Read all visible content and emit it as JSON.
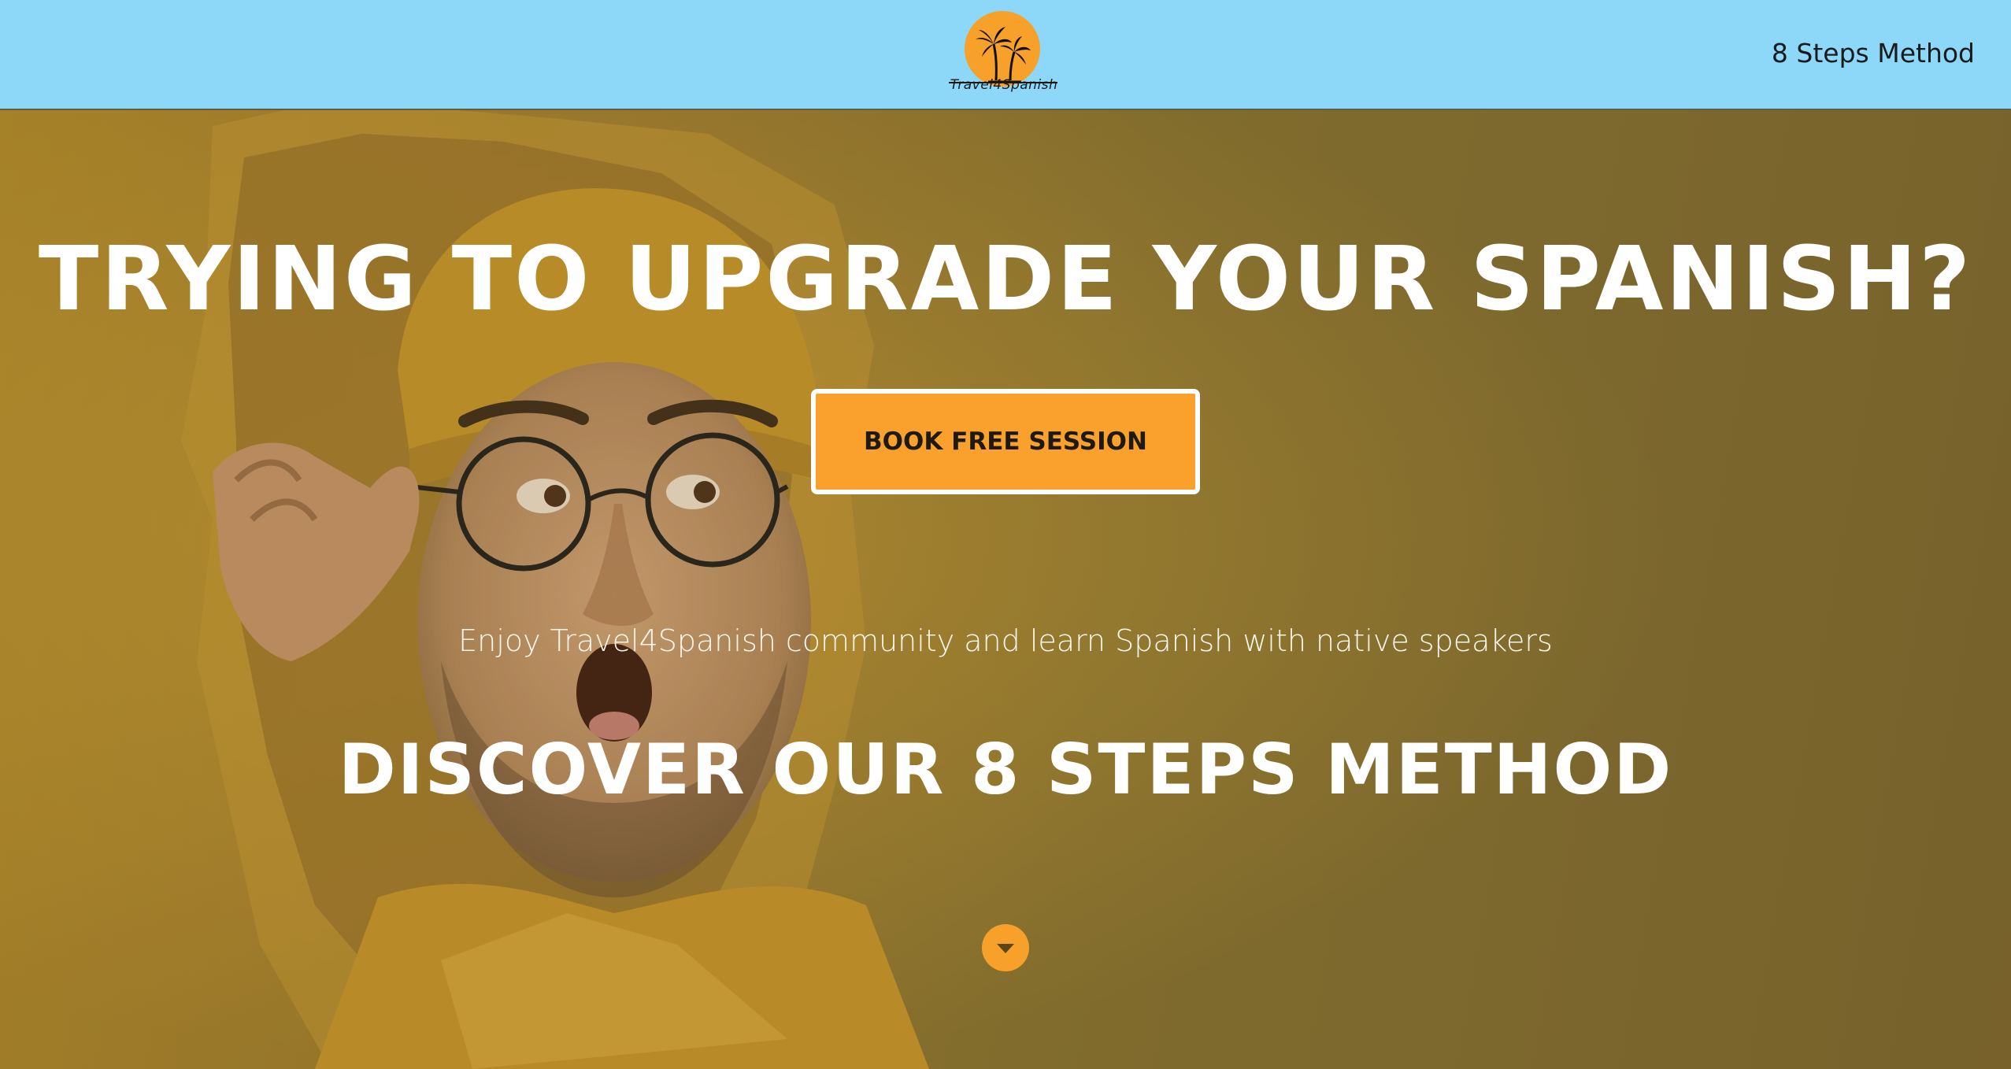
{
  "header": {
    "logo_text": "Travel4Spanish",
    "nav_link": "8 Steps Method"
  },
  "hero": {
    "title": "TRYING TO UPGRADE YOUR SPANISH?",
    "cta_label": "BOOK FREE SESSION",
    "subtitle": "Enjoy Travel4Spanish community and learn Spanish with native speakers",
    "section_title": "DISCOVER OUR 8 STEPS METHOD",
    "scroll_icon": "chevron-down-icon"
  },
  "colors": {
    "header_bg": "#8dd8f8",
    "accent": "#f9a12c",
    "hero_bg": "#857233"
  }
}
